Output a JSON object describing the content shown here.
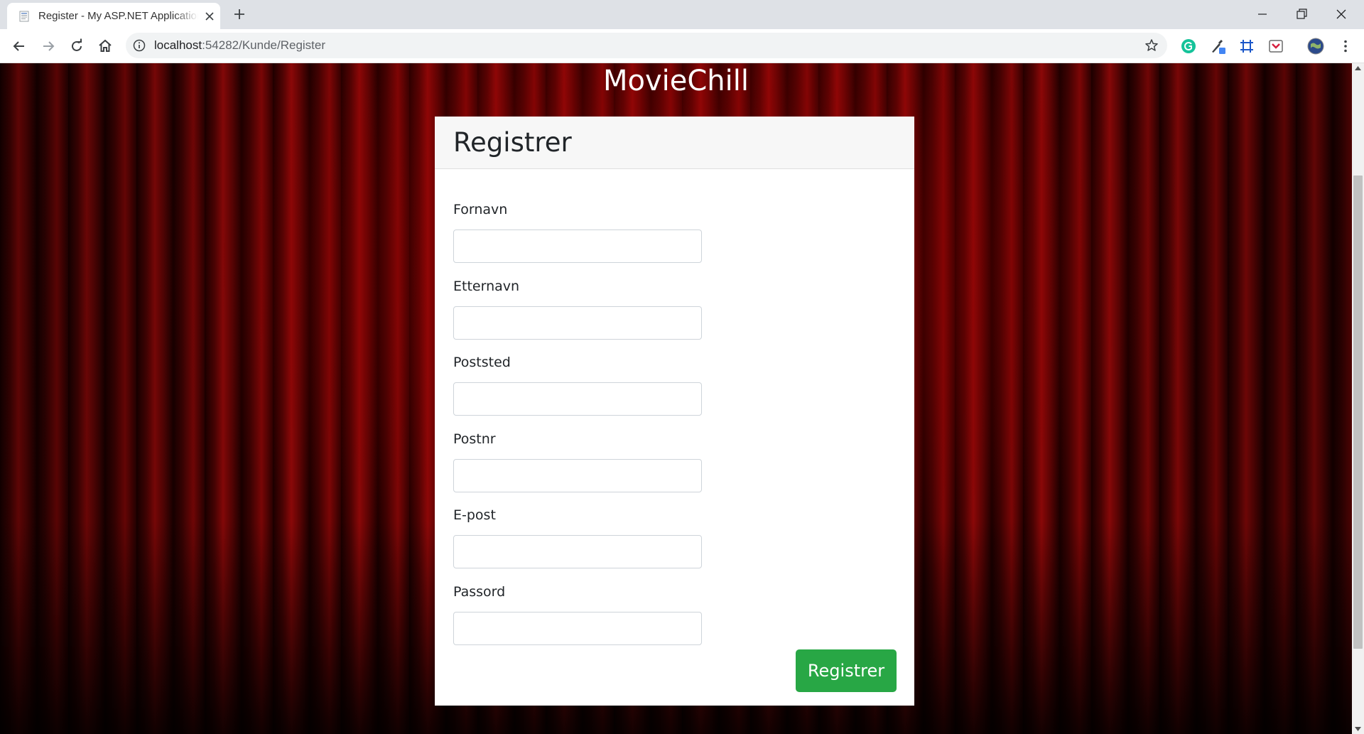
{
  "browser": {
    "tab_title": "Register - My ASP.NET Application",
    "url_host": "localhost",
    "url_path": ":54282/Kunde/Register"
  },
  "page": {
    "site_title": "MovieChill",
    "card_title": "Registrer",
    "fields": [
      {
        "label": "Fornavn",
        "value": ""
      },
      {
        "label": "Etternavn",
        "value": ""
      },
      {
        "label": "Poststed",
        "value": ""
      },
      {
        "label": "Postnr",
        "value": ""
      },
      {
        "label": "E-post",
        "value": ""
      },
      {
        "label": "Passord",
        "value": ""
      }
    ],
    "submit_label": "Registrer"
  },
  "icons": {
    "tab_favicon": "document-icon",
    "tab_close": "close-icon",
    "new_tab": "plus-icon",
    "back": "arrow-left-icon",
    "forward": "arrow-right-icon",
    "reload": "reload-icon",
    "home": "home-icon",
    "site_info": "info-icon",
    "bookmark": "star-icon",
    "extensions": [
      "grammarly-icon",
      "eyedropper-icon",
      "grid-ruler-icon",
      "pocket-icon"
    ],
    "profile": "avatar-globe-icon",
    "menu": "kebab-menu-icon"
  },
  "colors": {
    "submit_button": "#28a745",
    "curtain": "#7a0606",
    "chrome_tabstrip": "#dee1e6"
  }
}
